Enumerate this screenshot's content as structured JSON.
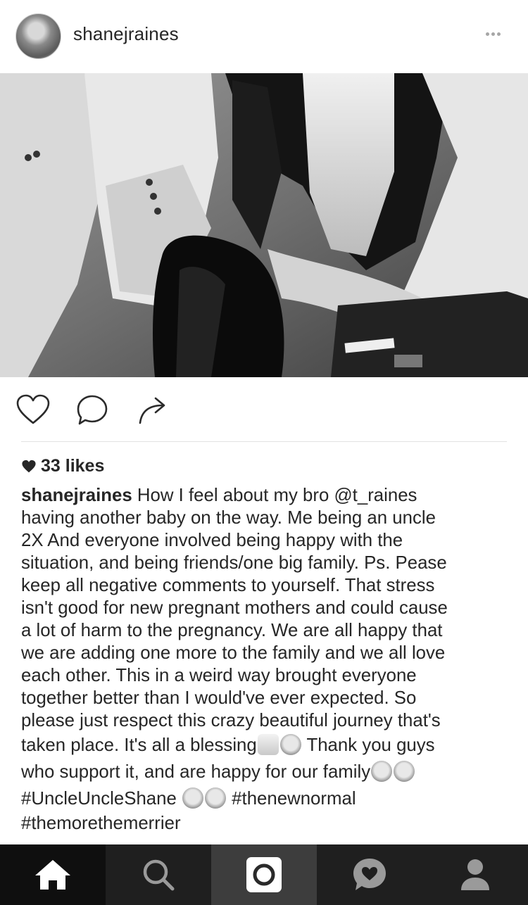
{
  "post": {
    "username": "shanejraines",
    "likes": "33 likes",
    "caption_username": "shanejraines",
    "caption_lines": [
      " How I feel about my bro @t_raines",
      "having another baby on the way. Me being an uncle",
      "2X And everyone involved being happy with the",
      "situation, and being friends/one big family. Ps. Pease",
      "keep all negative comments to yourself. That stress",
      "isn't good for new pregnant mothers and could cause",
      "a lot of harm to the pregnancy. We  are all happy that",
      "we are adding one more to the family and we all love",
      "each other. This in a weird way brought everyone",
      "together better than I would've ever expected. So",
      "please just respect this crazy beautiful journey that's"
    ],
    "line_blessing": "taken place. It's all a blessing",
    "line_thankyou": " Thank you guys",
    "line_support": "who support it, and are happy for our family",
    "hashtag_uncle": "#UncleUncleShane ",
    "hashtag_newnormal": " #thenewnormal",
    "hashtag_merrier": "#themorethemerrier"
  },
  "icons": {
    "more": "more-options-icon",
    "like": "heart-outline-icon",
    "comment": "comment-bubble-icon",
    "share": "share-arrow-icon",
    "likes_heart": "small-heart-icon",
    "emoji": [
      "raised-hands-emoji",
      "angel-emoji",
      "kiss-face-emoji",
      "baby-face-emoji"
    ]
  },
  "tabbar": {
    "tabs": [
      "home-icon",
      "search-icon",
      "camera-icon",
      "activity-heart-icon",
      "profile-icon"
    ]
  },
  "colors": {
    "text": "#262626",
    "tabbar_bg": "#1f1f1f",
    "tab_active_bg": "#0f0f0f",
    "camera_tab_bg": "#3d3d3d"
  }
}
